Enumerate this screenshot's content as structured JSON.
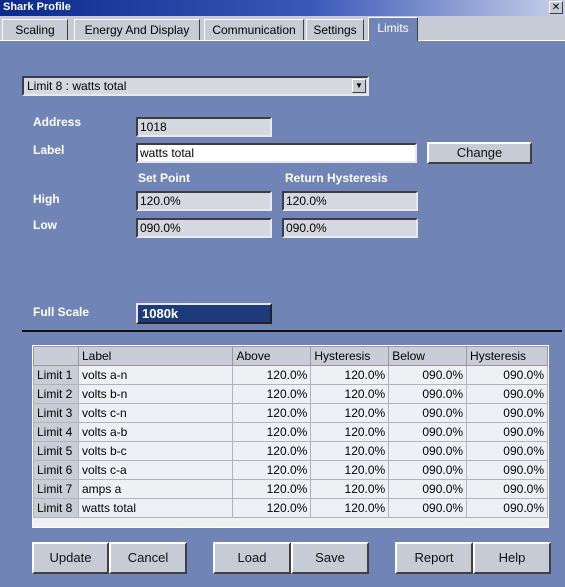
{
  "window": {
    "title": "Shark Profile",
    "close_glyph": "✕"
  },
  "tabs": [
    "Scaling",
    "Energy And Display",
    "Communication",
    "Settings",
    "Limits"
  ],
  "limit_select": {
    "value": "Limit 8 : watts total",
    "arrow_glyph": "▼"
  },
  "address": {
    "label": "Address",
    "value": "1018"
  },
  "label_field": {
    "label": "Label",
    "value": "watts total"
  },
  "change_button": "Change",
  "columns": {
    "set_point": "Set Point",
    "return_hysteresis": "Return Hysteresis"
  },
  "high": {
    "label": "High",
    "set_point": "120.0%",
    "return_hysteresis": "120.0%"
  },
  "low": {
    "label": "Low",
    "set_point": "090.0%",
    "return_hysteresis": "090.0%"
  },
  "full_scale": {
    "label": "Full Scale",
    "value": "1080k"
  },
  "table": {
    "headers": [
      "",
      "Label",
      "Above",
      "Hysteresis",
      "Below",
      "Hysteresis"
    ],
    "rows": [
      [
        "Limit 1",
        "volts a-n",
        "120.0%",
        "120.0%",
        "090.0%",
        "090.0%"
      ],
      [
        "Limit 2",
        "volts b-n",
        "120.0%",
        "120.0%",
        "090.0%",
        "090.0%"
      ],
      [
        "Limit 3",
        "volts c-n",
        "120.0%",
        "120.0%",
        "090.0%",
        "090.0%"
      ],
      [
        "Limit 4",
        "volts a-b",
        "120.0%",
        "120.0%",
        "090.0%",
        "090.0%"
      ],
      [
        "Limit 5",
        "volts b-c",
        "120.0%",
        "120.0%",
        "090.0%",
        "090.0%"
      ],
      [
        "Limit 6",
        "volts c-a",
        "120.0%",
        "120.0%",
        "090.0%",
        "090.0%"
      ],
      [
        "Limit 7",
        "amps a",
        "120.0%",
        "120.0%",
        "090.0%",
        "090.0%"
      ],
      [
        "Limit 8",
        "watts total",
        "120.0%",
        "120.0%",
        "090.0%",
        "090.0%"
      ]
    ]
  },
  "buttons": {
    "update": "Update",
    "cancel": "Cancel",
    "load": "Load",
    "save": "Save",
    "report": "Report",
    "help": "Help"
  },
  "colors": {
    "background": "#7084b6",
    "titlebar": "#0c2a8c",
    "full_scale_bg": "#1e3a7a"
  }
}
